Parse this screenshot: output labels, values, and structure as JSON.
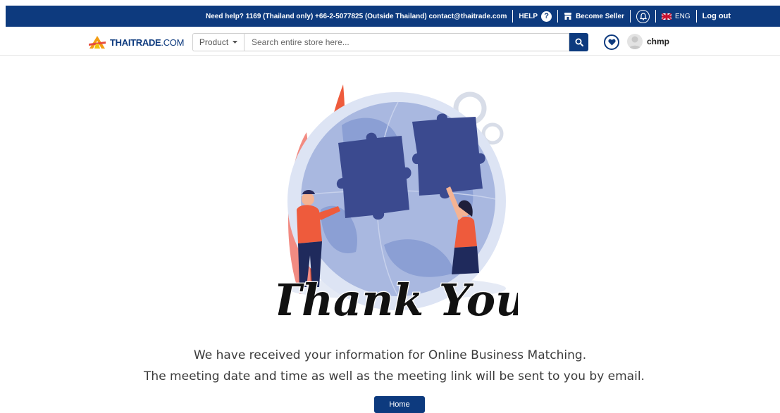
{
  "topbar": {
    "help_text": "Need help? 1169 (Thailand only) +66-2-5077825 (Outside Thailand) contact@thaitrade.com",
    "help_label": "HELP",
    "help_icon": "?",
    "seller_label": "Become Seller",
    "language_label": "ENG",
    "logout_label": "Log out"
  },
  "header": {
    "logo_main": "THAITRADE",
    "logo_suffix": ".COM",
    "product_select": "Product",
    "search_placeholder": "Search entire store here...",
    "username": "chmp"
  },
  "main": {
    "illustration_text": "Thank You",
    "message_line1": "We have received your information for Online Business Matching.",
    "message_line2": "The meeting date and time as well as the meeting link will be sent to you by email.",
    "home_button": "Home"
  },
  "colors": {
    "brand": "#0d3a7e",
    "accent": "#ee5b3c"
  }
}
